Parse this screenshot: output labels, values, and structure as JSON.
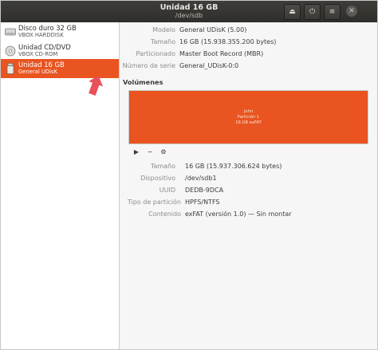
{
  "window": {
    "title": "Unidad 16 GB",
    "subtitle": "/dev/sdb",
    "buttons": {
      "eject": "⏏",
      "power": "⏻",
      "menu": "≡",
      "close": "✕"
    }
  },
  "sidebar": {
    "devices": [
      {
        "name": "Disco duro 32 GB",
        "detail": "VBOX HARDDISK",
        "icon": "hard-disk-icon"
      },
      {
        "name": "Unidad CD/DVD",
        "detail": "VBOX CD-ROM",
        "icon": "optical-drive-icon"
      },
      {
        "name": "Unidad 16 GB",
        "detail": "General UDisK",
        "icon": "usb-drive-icon",
        "selected": true
      }
    ]
  },
  "drive": {
    "rows": [
      {
        "label": "Modelo",
        "value": "General UDisK (5.00)"
      },
      {
        "label": "Tamaño",
        "value": "16 GB (15.938.355.200 bytes)"
      },
      {
        "label": "Particionado",
        "value": "Master Boot Record (MBR)"
      },
      {
        "label": "Número de serie",
        "value": "General_UDisK-0:0"
      }
    ]
  },
  "volumes": {
    "header": "Volúmenes",
    "partition": {
      "line1": "John",
      "line2": "Partición 1",
      "line3": "16 GB exFAT",
      "color": "#e95420"
    },
    "controls": {
      "play": "▶",
      "minus": "−",
      "settings": "⚙"
    },
    "rows": [
      {
        "label": "Tamaño",
        "value": "16 GB (15.937.306.624 bytes)"
      },
      {
        "label": "Dispositivo",
        "value": "/dev/sdb1"
      },
      {
        "label": "UUID",
        "value": "DEDB-9DCA"
      },
      {
        "label": "Tipo de partición",
        "value": "HPFS/NTFS"
      },
      {
        "label": "Contenido",
        "value": "exFAT (versión 1.0) — Sin montar"
      }
    ]
  },
  "colors": {
    "accent": "#e95420",
    "titlebar": "#3a3935",
    "annotation_arrow": "#e8505b"
  }
}
